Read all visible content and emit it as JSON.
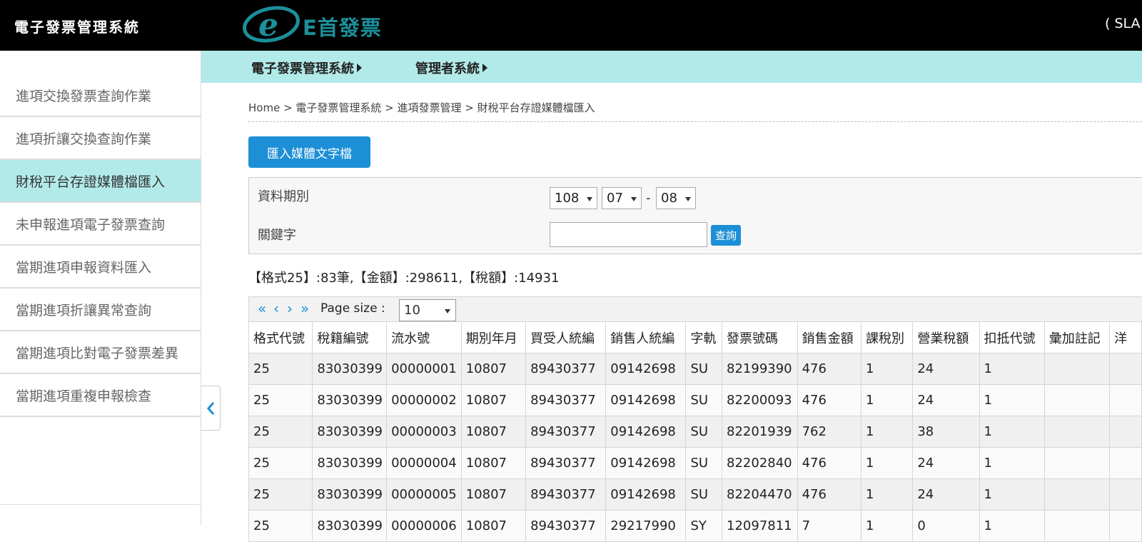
{
  "header": {
    "system_title": "電子發票管理系統",
    "logo_text": "E首發票",
    "user_text": "( SLA"
  },
  "topnav": {
    "items": [
      {
        "label": "電子發票管理系統"
      },
      {
        "label": "管理者系統"
      }
    ]
  },
  "sidebar": {
    "items": [
      {
        "label": "進項交換發票查詢作業"
      },
      {
        "label": "進項折讓交換查詢作業"
      },
      {
        "label": "財稅平台存證媒體檔匯入",
        "active": true
      },
      {
        "label": "未申報進項電子發票查詢"
      },
      {
        "label": "當期進項申報資料匯入"
      },
      {
        "label": "當期進項折讓異常查詢"
      },
      {
        "label": "當期進項比對電子發票差異"
      },
      {
        "label": "當期進項重複申報檢查"
      }
    ]
  },
  "breadcrumb": "Home > 電子發票管理系統 > 進項發票管理 > 財稅平台存證媒體檔匯入",
  "import_button": "匯入媒體文字檔",
  "filter": {
    "period_label": "資料期別",
    "year": "108",
    "month_from": "07",
    "separator": "-",
    "month_to": "08",
    "keyword_label": "關鍵字",
    "keyword_value": "",
    "query_button": "查詢"
  },
  "summary": "【格式25】:83筆,【金額】:298611,【稅額】:14931",
  "pager": {
    "first": "«",
    "prev": "‹",
    "next": "›",
    "last": "»",
    "page_size_label": "Page size :",
    "page_size": "10"
  },
  "table": {
    "columns": [
      "格式代號",
      "稅籍編號",
      "流水號",
      "期別年月",
      "買受人統編",
      "銷售人統編",
      "字軌",
      "發票號碼",
      "銷售金額",
      "課稅別",
      "營業稅額",
      "扣抵代號",
      "彙加註記",
      "洋"
    ],
    "rows": [
      [
        "25",
        "83030399",
        "00000001",
        "10807",
        "89430377",
        "09142698",
        "SU",
        "82199390",
        "476",
        "1",
        "24",
        "1",
        "",
        ""
      ],
      [
        "25",
        "83030399",
        "00000002",
        "10807",
        "89430377",
        "09142698",
        "SU",
        "82200093",
        "476",
        "1",
        "24",
        "1",
        "",
        ""
      ],
      [
        "25",
        "83030399",
        "00000003",
        "10807",
        "89430377",
        "09142698",
        "SU",
        "82201939",
        "762",
        "1",
        "38",
        "1",
        "",
        ""
      ],
      [
        "25",
        "83030399",
        "00000004",
        "10807",
        "89430377",
        "09142698",
        "SU",
        "82202840",
        "476",
        "1",
        "24",
        "1",
        "",
        ""
      ],
      [
        "25",
        "83030399",
        "00000005",
        "10807",
        "89430377",
        "09142698",
        "SU",
        "82204470",
        "476",
        "1",
        "24",
        "1",
        "",
        ""
      ],
      [
        "25",
        "83030399",
        "00000006",
        "10807",
        "89430377",
        "29217990",
        "SY",
        "12097811",
        "7",
        "1",
        "0",
        "1",
        "",
        ""
      ]
    ]
  }
}
